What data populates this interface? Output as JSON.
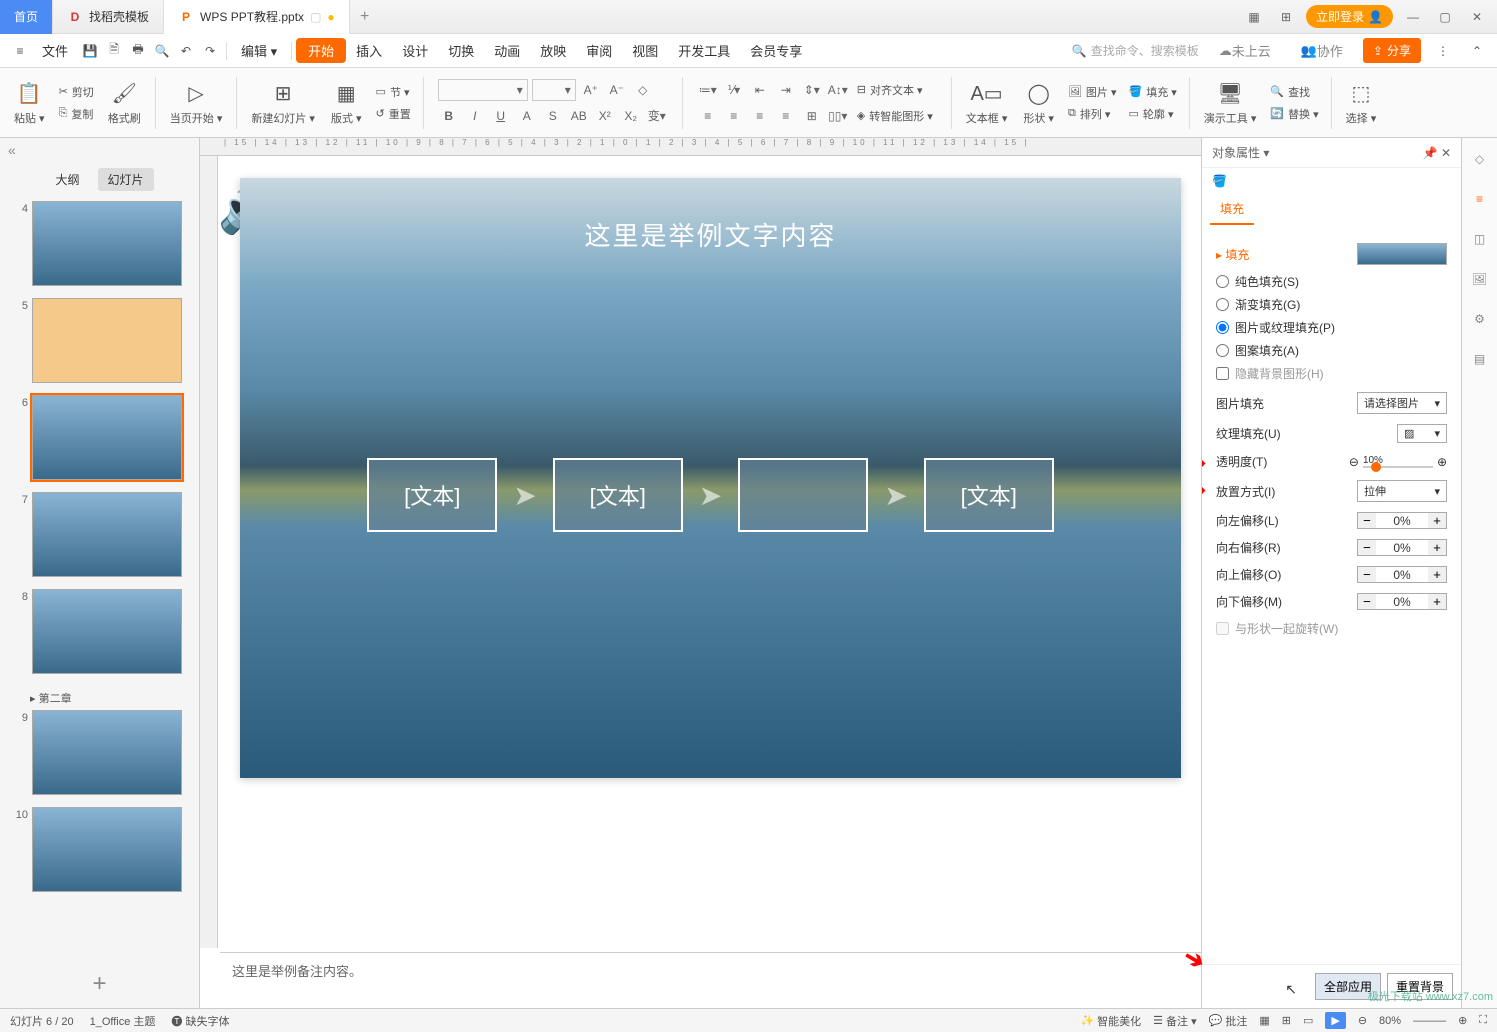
{
  "titlebar": {
    "home": "首页",
    "tab_template_icon": "D",
    "tab_template": "找稻壳模板",
    "tab_file": "WPS PPT教程.pptx",
    "login": "立即登录"
  },
  "menubar": {
    "file": "文件",
    "edit": "编辑 ▾",
    "tabs": [
      "开始",
      "插入",
      "设计",
      "切换",
      "动画",
      "放映",
      "审阅",
      "视图",
      "开发工具",
      "会员专享"
    ],
    "active": "开始",
    "search_placeholder": "查找命令、搜索模板",
    "cloud": "未上云",
    "collab": "协作",
    "share": "分享"
  },
  "ribbon": {
    "paste": "粘贴 ▾",
    "cut": "剪切",
    "copy": "复制",
    "format_painter": "格式刷",
    "page_start": "当页开始 ▾",
    "new_slide": "新建幻灯片 ▾",
    "layout": "版式 ▾",
    "section": "节 ▾",
    "reset": "重置",
    "align_text": "对齐文本 ▾",
    "smart_shape": "转智能图形 ▾",
    "textbox": "文本框 ▾",
    "shape": "形状 ▾",
    "image": "图片 ▾",
    "arrange": "排列 ▾",
    "fill": "填充 ▾",
    "outline": "轮廓 ▾",
    "demo_tool": "演示工具 ▾",
    "find": "查找",
    "replace": "替换 ▾",
    "select": "选择 ▾"
  },
  "thumb": {
    "outline": "大纲",
    "slides": "幻灯片",
    "chapter2": "▸ 第二章",
    "nums": [
      "4",
      "5",
      "6",
      "7",
      "8",
      "9",
      "10"
    ]
  },
  "slide": {
    "title": "这里是举例文字内容",
    "box_text": "[文本]",
    "notes": "这里是举例备注内容。",
    "ruler": "| 15 | 14 | 13 | 12 | 11 | 10 | 9 | 8 | 7 | 6 | 5 | 4 | 3 | 2 | 1 | 0 | 1 | 2 | 3 | 4 | 5 | 6 | 7 | 8 | 9 | 10 | 11 | 12 | 13 | 14 | 15 |"
  },
  "props": {
    "header": "对象属性 ▾",
    "tab_fill": "填充",
    "section_fill": "▸ 填充",
    "solid": "纯色填充(S)",
    "gradient": "渐变填充(G)",
    "picture": "图片或纹理填充(P)",
    "pattern": "图案填充(A)",
    "hide_bg": "隐藏背景图形(H)",
    "image_fill": "图片填充",
    "image_fill_select": "请选择图片",
    "texture_fill": "纹理填充(U)",
    "transparency": "透明度(T)",
    "transparency_val": "10%",
    "placement": "放置方式(I)",
    "placement_val": "拉伸",
    "offset_left": "向左偏移(L)",
    "offset_right": "向右偏移(R)",
    "offset_top": "向上偏移(O)",
    "offset_bottom": "向下偏移(M)",
    "offset_val": "0%",
    "rotate_with": "与形状一起旋转(W)",
    "apply_all": "全部应用",
    "reset_bg": "重置背景"
  },
  "status": {
    "slide_count": "幻灯片 6 / 20",
    "theme": "1_Office 主题",
    "missing_font": "缺失字体",
    "beautify": "智能美化",
    "notes": "备注 ▾",
    "comments": "批注",
    "zoom": "80%",
    "watermark": "极光下载站  www.xz7.com"
  }
}
